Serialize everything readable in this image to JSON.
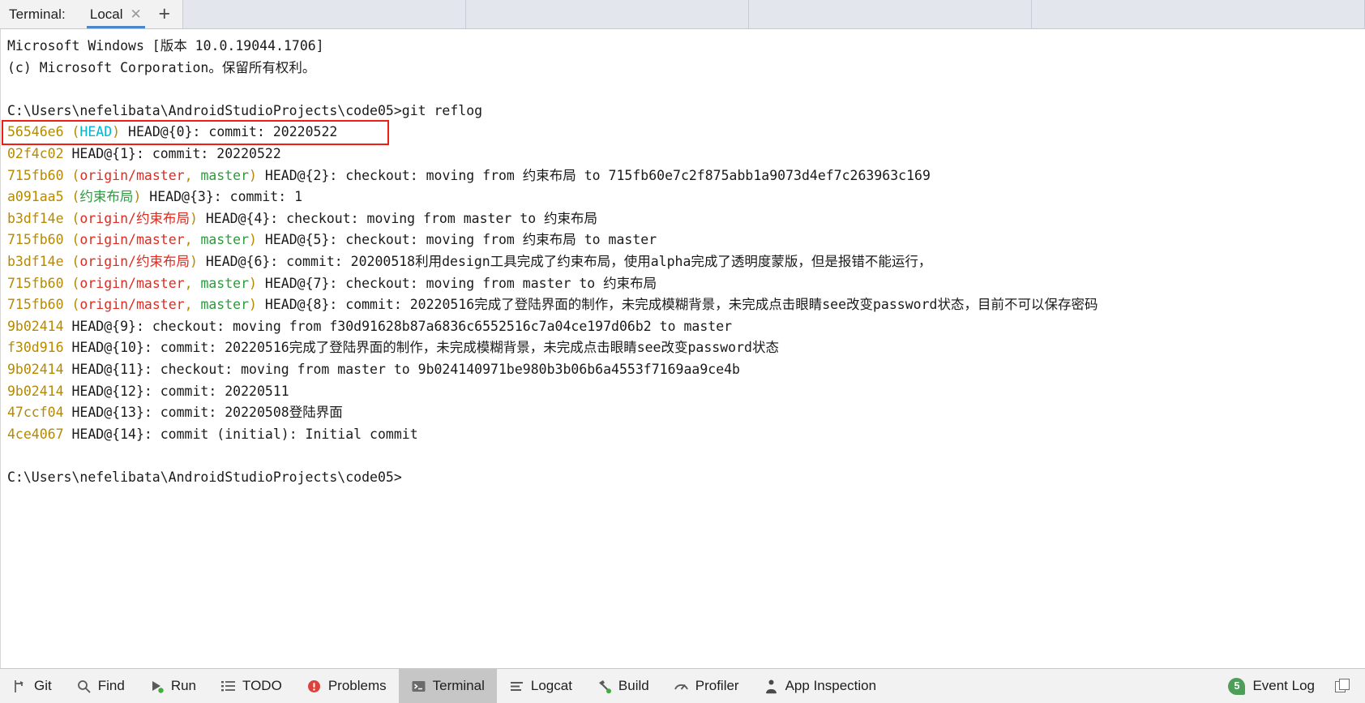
{
  "tabbar": {
    "terminal_label": "Terminal:",
    "tab_name": "Local",
    "close_icon": "close-icon",
    "add_icon": "plus-icon"
  },
  "terminal": {
    "header_lines": [
      "Microsoft Windows [版本 10.0.19044.1706]",
      "(c) Microsoft Corporation。保留所有权利。",
      "",
      "C:\\Users\\nefelibata\\AndroidStudioProjects\\code05>git reflog"
    ],
    "reflog": [
      {
        "hash": "56546e6",
        "refs": [
          {
            "text": "(",
            "color": "paren"
          },
          {
            "text": "HEAD",
            "color": "head"
          },
          {
            "text": ")",
            "color": "paren"
          }
        ],
        "body": " HEAD@{0}: commit: 20220522",
        "highlighted": true
      },
      {
        "hash": "02f4c02",
        "refs": [],
        "body": " HEAD@{1}: commit: 20220522",
        "highlighted": false
      },
      {
        "hash": "715fb60",
        "refs": [
          {
            "text": "(",
            "color": "paren"
          },
          {
            "text": "origin/master",
            "color": "remote"
          },
          {
            "text": ", ",
            "color": "paren"
          },
          {
            "text": "master",
            "color": "local"
          },
          {
            "text": ")",
            "color": "paren"
          }
        ],
        "body": " HEAD@{2}: checkout: moving from 约束布局 to 715fb60e7c2f875abb1a9073d4ef7c263963c169",
        "highlighted": false
      },
      {
        "hash": "a091aa5",
        "refs": [
          {
            "text": "(",
            "color": "paren"
          },
          {
            "text": "约束布局",
            "color": "local"
          },
          {
            "text": ")",
            "color": "paren"
          }
        ],
        "body": " HEAD@{3}: commit: 1",
        "highlighted": false
      },
      {
        "hash": "b3df14e",
        "refs": [
          {
            "text": "(",
            "color": "paren"
          },
          {
            "text": "origin/约束布局",
            "color": "remote"
          },
          {
            "text": ")",
            "color": "paren"
          }
        ],
        "body": " HEAD@{4}: checkout: moving from master to 约束布局",
        "highlighted": false
      },
      {
        "hash": "715fb60",
        "refs": [
          {
            "text": "(",
            "color": "paren"
          },
          {
            "text": "origin/master",
            "color": "remote"
          },
          {
            "text": ", ",
            "color": "paren"
          },
          {
            "text": "master",
            "color": "local"
          },
          {
            "text": ")",
            "color": "paren"
          }
        ],
        "body": " HEAD@{5}: checkout: moving from 约束布局 to master",
        "highlighted": false
      },
      {
        "hash": "b3df14e",
        "refs": [
          {
            "text": "(",
            "color": "paren"
          },
          {
            "text": "origin/约束布局",
            "color": "remote"
          },
          {
            "text": ")",
            "color": "paren"
          }
        ],
        "body": " HEAD@{6}: commit: 20200518利用design工具完成了约束布局，使用alpha完成了透明度蒙版，但是报错不能运行，",
        "highlighted": false
      },
      {
        "hash": "715fb60",
        "refs": [
          {
            "text": "(",
            "color": "paren"
          },
          {
            "text": "origin/master",
            "color": "remote"
          },
          {
            "text": ", ",
            "color": "paren"
          },
          {
            "text": "master",
            "color": "local"
          },
          {
            "text": ")",
            "color": "paren"
          }
        ],
        "body": " HEAD@{7}: checkout: moving from master to 约束布局",
        "highlighted": false
      },
      {
        "hash": "715fb60",
        "refs": [
          {
            "text": "(",
            "color": "paren"
          },
          {
            "text": "origin/master",
            "color": "remote"
          },
          {
            "text": ", ",
            "color": "paren"
          },
          {
            "text": "master",
            "color": "local"
          },
          {
            "text": ")",
            "color": "paren"
          }
        ],
        "body": " HEAD@{8}: commit: 20220516完成了登陆界面的制作，未完成模糊背景，未完成点击眼睛see改变password状态，目前不可以保存密码",
        "highlighted": false
      },
      {
        "hash": "9b02414",
        "refs": [],
        "body": " HEAD@{9}: checkout: moving from f30d91628b87a6836c6552516c7a04ce197d06b2 to master",
        "highlighted": false
      },
      {
        "hash": "f30d916",
        "refs": [],
        "body": " HEAD@{10}: commit: 20220516完成了登陆界面的制作，未完成模糊背景，未完成点击眼睛see改变password状态",
        "highlighted": false
      },
      {
        "hash": "9b02414",
        "refs": [],
        "body": " HEAD@{11}: checkout: moving from master to 9b024140971be980b3b06b6a4553f7169aa9ce4b",
        "highlighted": false
      },
      {
        "hash": "9b02414",
        "refs": [],
        "body": " HEAD@{12}: commit: 20220511",
        "highlighted": false
      },
      {
        "hash": "47ccf04",
        "refs": [],
        "body": " HEAD@{13}: commit: 20220508登陆界面",
        "highlighted": false
      },
      {
        "hash": "4ce4067",
        "refs": [],
        "body": " HEAD@{14}: commit (initial): Initial commit",
        "highlighted": false
      }
    ],
    "trailing_lines": [
      "",
      "C:\\Users\\nefelibata\\AndroidStudioProjects\\code05>"
    ]
  },
  "statusbar": {
    "items": [
      {
        "label": "Git",
        "icon": "git-branch-icon",
        "active": false
      },
      {
        "label": "Find",
        "icon": "magnifier-icon",
        "active": false
      },
      {
        "label": "Run",
        "icon": "run-play-icon",
        "active": false
      },
      {
        "label": "TODO",
        "icon": "todo-list-icon",
        "active": false
      },
      {
        "label": "Problems",
        "icon": "error-circle-icon",
        "active": false
      },
      {
        "label": "Terminal",
        "icon": "terminal-icon",
        "active": true
      },
      {
        "label": "Logcat",
        "icon": "logcat-lines-icon",
        "active": false
      },
      {
        "label": "Build",
        "icon": "hammer-icon",
        "active": false
      },
      {
        "label": "Profiler",
        "icon": "gauge-icon",
        "active": false
      },
      {
        "label": "App Inspection",
        "icon": "app-inspection-icon",
        "active": false
      }
    ],
    "event_log": {
      "label": "Event Log",
      "count": "5"
    },
    "corner_icon": "restore-layout-icon"
  },
  "colors": {
    "hash": "#b58900",
    "head": "#00b8d4",
    "remote": "#e02b20",
    "local": "#2a9c3b",
    "highlight_box": "#f01f14",
    "tab_underline": "#4a86c8",
    "badge_green": "#4e9e5a"
  }
}
